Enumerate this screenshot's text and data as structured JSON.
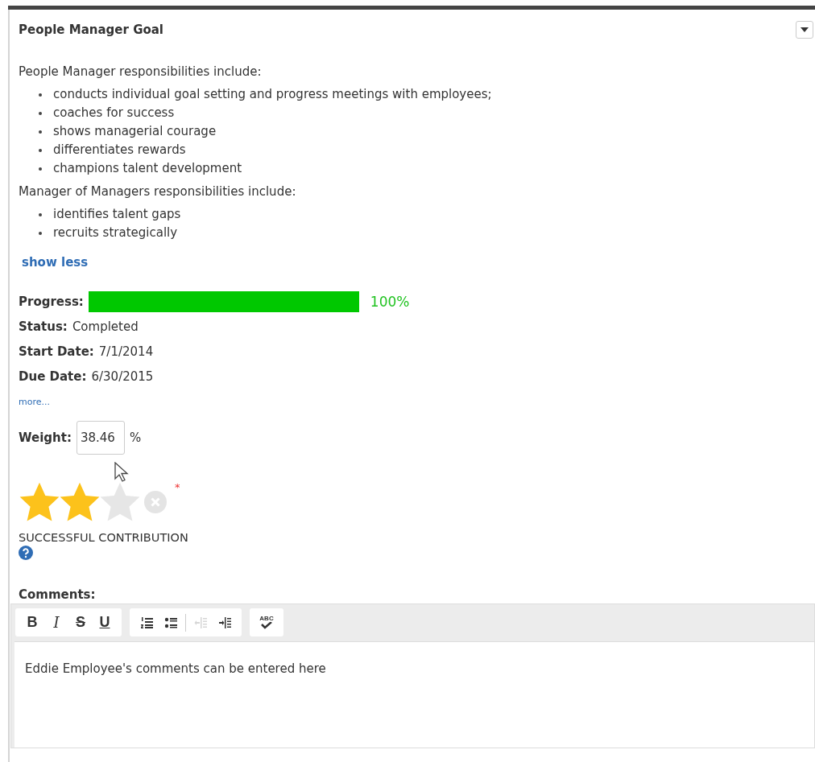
{
  "title": "People Manager Goal",
  "description": [
    {
      "kind": "paragraph",
      "text": "People Manager responsibilities include:"
    },
    {
      "kind": "list",
      "items": [
        "conducts individual goal setting and progress meetings with employees;",
        "coaches for success",
        "shows managerial courage",
        "differentiates rewards",
        "champions talent development"
      ]
    },
    {
      "kind": "paragraph",
      "text": "Manager of Managers responsibilities include:"
    },
    {
      "kind": "list",
      "items": [
        "identifies talent gaps",
        "recruits strategically"
      ]
    }
  ],
  "show_less": "show less",
  "progress": {
    "label": "Progress:",
    "level": 1,
    "reading": "100%"
  },
  "fields": [
    {
      "label": "Status:",
      "value": "Completed"
    },
    {
      "label": "Start Date:",
      "value": "7/1/2014"
    },
    {
      "label": "Due Date:",
      "value": "6/30/2015"
    }
  ],
  "more": "more...",
  "weight": {
    "label": "Weight:",
    "value": "38.46",
    "unit": "%"
  },
  "rating": {
    "stars": 2,
    "required_mark": "*",
    "label": "SUCCESSFUL CONTRIBUTION"
  },
  "comments": {
    "label": "Comments:",
    "value": "Eddie Employee's comments can be entered here",
    "toolbar": [
      [
        {
          "kind": "bold",
          "text": "B",
          "disabled": false
        },
        {
          "kind": "italic",
          "text": "I",
          "disabled": false
        },
        {
          "kind": "strike",
          "text": "S",
          "disabled": false
        },
        {
          "kind": "underline",
          "text": "U",
          "disabled": false
        }
      ],
      [
        {
          "kind": "numbered",
          "disabled": false
        },
        {
          "kind": "bulleted",
          "disabled": false
        },
        {
          "kind": "outdent",
          "disabled": true
        },
        {
          "kind": "indent",
          "disabled": false
        }
      ],
      [
        {
          "kind": "spell",
          "text": "ABC",
          "disabled": false
        }
      ]
    ]
  }
}
